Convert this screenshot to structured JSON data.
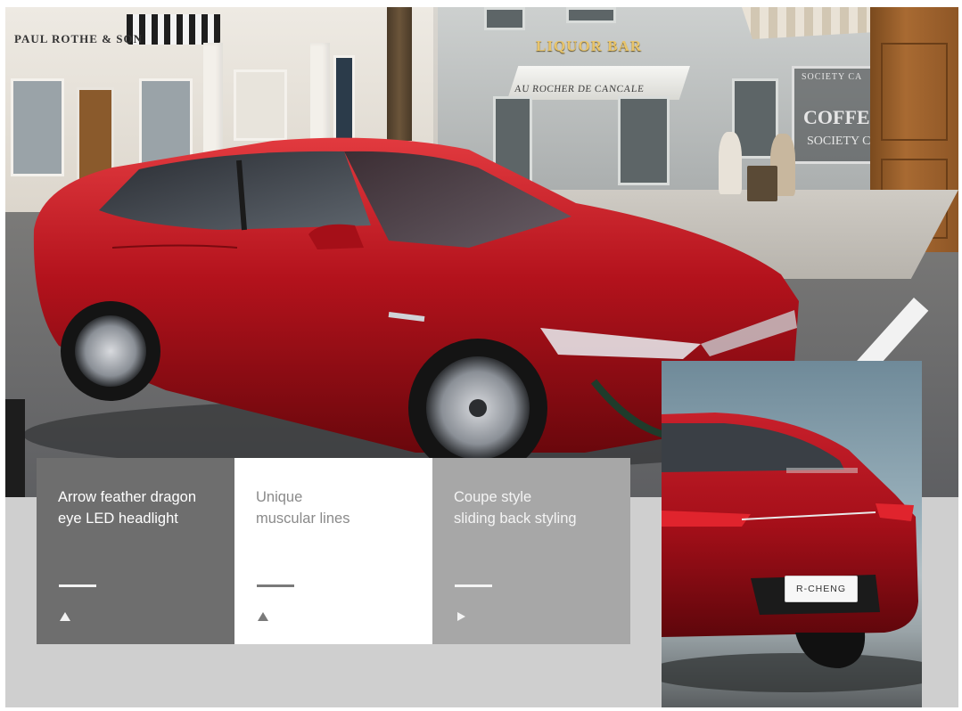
{
  "scene": {
    "signs": {
      "left_shop": "PAUL ROTHE & SON",
      "bar": "LIQUOR BAR",
      "awning": "AU ROCHER DE CANCALE",
      "coffee_top": "SOCIETY CA",
      "coffee_main": "COFFE",
      "coffee_sub": "SOCIETY CA"
    }
  },
  "features": [
    {
      "title": "Arrow feather dragon\neye LED headlight",
      "arrow": "triangle-up-icon"
    },
    {
      "title": "Unique\nmuscular lines",
      "arrow": "triangle-up-icon"
    },
    {
      "title": "Coupe style\nsliding back styling",
      "arrow": "triangle-right-icon"
    }
  ],
  "rear_photo": {
    "plate": "R-CHENG"
  },
  "colors": {
    "car_red": "#b3121c",
    "tile_dark": "#6e6e6e",
    "tile_light": "#ffffff",
    "tile_mid": "#a7a7a7",
    "page_bg": "#cfcfcf"
  }
}
